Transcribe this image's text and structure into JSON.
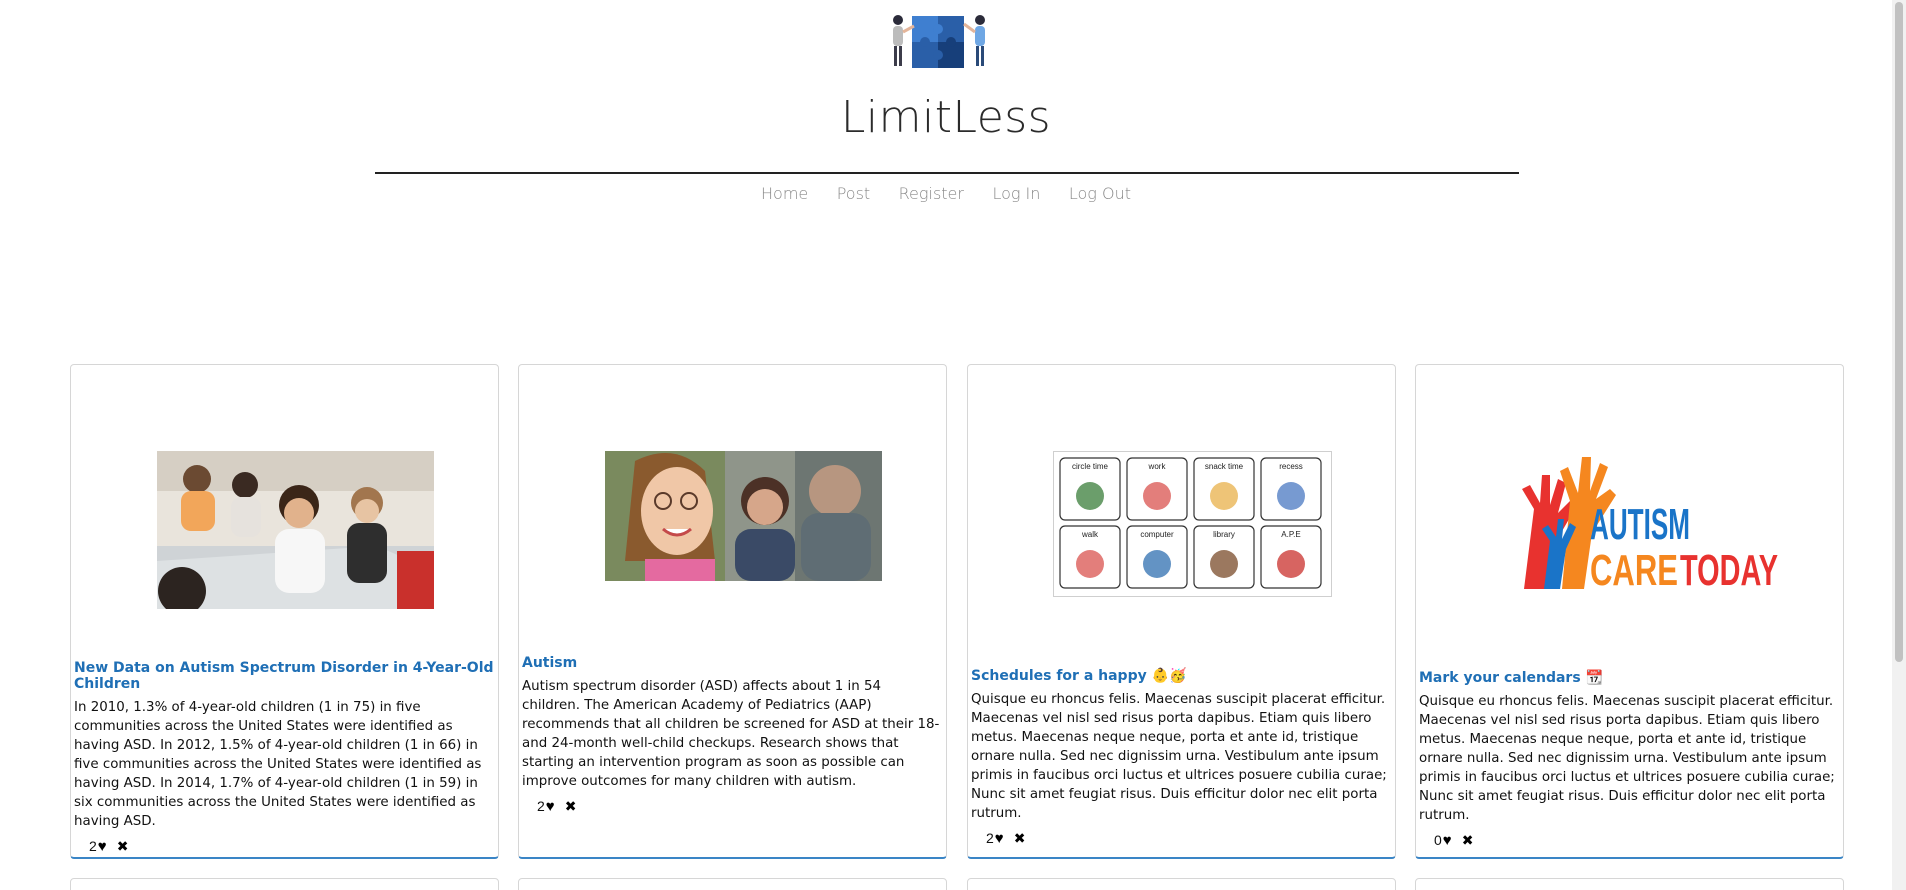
{
  "site": {
    "title": "LimitLess",
    "logo_icon": "puzzle-people-logo"
  },
  "nav": {
    "items": [
      {
        "label": "Home"
      },
      {
        "label": "Post"
      },
      {
        "label": "Register"
      },
      {
        "label": "Log In"
      },
      {
        "label": "Log Out"
      }
    ]
  },
  "posts": [
    {
      "title": "New Data on Autism Spectrum Disorder in 4-Year-Old Children",
      "text": "In 2010, 1.3% of 4-year-old children (1 in 75) in five communities across the United States were identified as having ASD. In 2012, 1.5% of 4-year-old children (1 in 66) in five communities across the United States were identified as having ASD. In 2014, 1.7% of 4-year-old children (1 in 59) in six communities across the United States were identified as having ASD.",
      "likes": "2",
      "image": "children-at-table-photo"
    },
    {
      "title": "Autism",
      "text": "Autism spectrum disorder (ASD) affects about 1 in 54 children. The American Academy of Pediatrics (AAP) recommends that all children be screened for ASD at their 18- and 24-month well-child checkups. Research shows that starting an intervention program as soon as possible can improve outcomes for many children with autism.",
      "likes": "2",
      "image": "smiling-girl-photo"
    },
    {
      "title": "Schedules for a happy 👶🥳",
      "text": "Quisque eu rhoncus felis. Maecenas suscipit placerat efficitur. Maecenas vel nisl sed risus porta dapibus. Etiam quis libero metus. Maecenas neque neque, porta et ante id, tristique ornare nulla. Sed nec dignissim urna. Vestibulum ante ipsum primis in faucibus orci luctus et ultrices posuere cubilia curae; Nunc sit amet feugiat risus. Duis efficitur dolor nec elit porta rutrum.",
      "likes": "2",
      "image": "visual-schedule-chart",
      "schedule_labels": [
        "circle time",
        "work",
        "snack time",
        "recess",
        "walk",
        "computer",
        "library",
        "A.P.E"
      ]
    },
    {
      "title": "Mark your calendars 📆",
      "text": "Quisque eu rhoncus felis. Maecenas suscipit placerat efficitur. Maecenas vel nisl sed risus porta dapibus. Etiam quis libero metus. Maecenas neque neque, porta et ante id, tristique ornare nulla. Sed nec dignissim urna. Vestibulum ante ipsum primis in faucibus orci luctus et ultrices posuere cubilia curae; Nunc sit amet feugiat risus. Duis efficitur dolor nec elit porta rutrum.",
      "likes": "0",
      "image": "autism-care-today-logo",
      "logo_text": [
        "AUTISM",
        "CARE",
        "TODAY"
      ]
    }
  ],
  "icons": {
    "heart": "♥",
    "delete": "✖"
  },
  "colors": {
    "link": "#1f6fb5",
    "card_accent": "#3a85c6",
    "logo_blue": "#1a74c8",
    "logo_orange": "#f5871f",
    "logo_red": "#e8322f"
  }
}
